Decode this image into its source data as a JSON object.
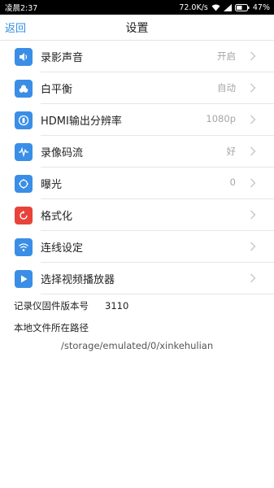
{
  "status_bar": {
    "time": "凌晨2:37",
    "network_speed": "72.0K/s",
    "battery": "47%"
  },
  "nav": {
    "back_label": "返回",
    "title": "设置"
  },
  "settings": [
    {
      "label": "录影声音",
      "value": "开启",
      "icon": "speaker-icon",
      "color": "#3a8ee6"
    },
    {
      "label": "白平衡",
      "value": "自动",
      "icon": "cloud-icon",
      "color": "#3a8ee6"
    },
    {
      "label": "HDMI输出分辨率",
      "value": "1080p",
      "icon": "hdmi-icon",
      "color": "#3a8ee6"
    },
    {
      "label": "录像码流",
      "value": "好",
      "icon": "waveform-icon",
      "color": "#3a8ee6"
    },
    {
      "label": "曝光",
      "value": "0",
      "icon": "exposure-icon",
      "color": "#3a8ee6"
    },
    {
      "label": "格式化",
      "value": "",
      "icon": "refresh-icon",
      "color": "#e8433a"
    },
    {
      "label": "连线设定",
      "value": "",
      "icon": "wifi-icon",
      "color": "#3a8ee6"
    },
    {
      "label": "选择视频播放器",
      "value": "",
      "icon": "play-icon",
      "color": "#3a8ee6"
    }
  ],
  "info": {
    "firmware_label": "记录仪固件版本号",
    "firmware_value": "3110",
    "path_label": "本地文件所在路径",
    "path_value": "/storage/emulated/0/xinkehulian"
  }
}
